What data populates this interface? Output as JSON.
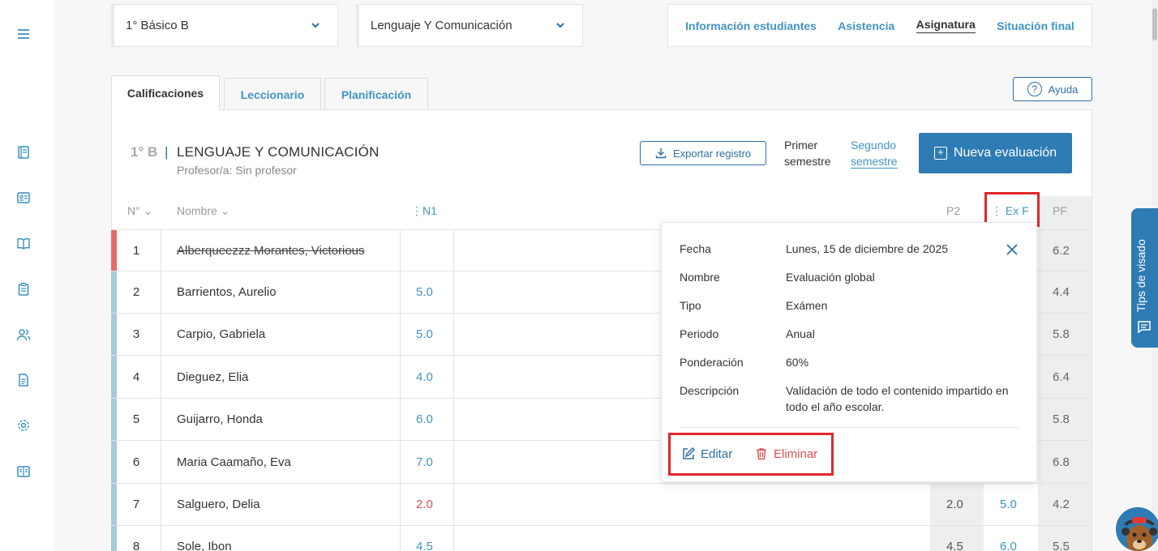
{
  "selects": {
    "curso": "1° Básico B",
    "asignatura": "Lenguaje Y Comunicación"
  },
  "topnav": [
    "Información estudiantes",
    "Asistencia",
    "Asignatura",
    "Situación final"
  ],
  "tabs": [
    "Calificaciones",
    "Leccionario",
    "Planificación"
  ],
  "help": "Ayuda",
  "course": {
    "code": "1° B",
    "separator": "|",
    "name": "LENGUAJE Y COMUNICACIÓN",
    "teacher": "Profesor/a: Sin profesor"
  },
  "actions": {
    "export": "Exportar registro",
    "sem1_line1": "Primer",
    "sem1_line2": "semestre",
    "sem2_line1": "Segundo",
    "sem2_line2": "semestre",
    "new_eval": "Nueva evaluación"
  },
  "table_header": {
    "num": "N°",
    "name": "Nombre",
    "n1": "N1",
    "p2": "P2",
    "exf": "Ex F",
    "pf": "PF"
  },
  "rows": [
    {
      "num": "1",
      "name": "Alberqueezzz Morantes, Victorious",
      "n1": "",
      "p2": "",
      "exf": "",
      "pf": "6.2"
    },
    {
      "num": "2",
      "name": "Barrientos, Aurelio",
      "n1": "5.0",
      "p2": "",
      "exf": "",
      "pf": "4.4"
    },
    {
      "num": "3",
      "name": "Carpio, Gabriela",
      "n1": "5.0",
      "p2": "",
      "exf": "",
      "pf": "5.8"
    },
    {
      "num": "4",
      "name": "Dieguez, Elia",
      "n1": "4.0",
      "p2": "",
      "exf": "",
      "pf": "6.4"
    },
    {
      "num": "5",
      "name": "Guijarro, Honda",
      "n1": "6.0",
      "p2": "",
      "exf": "",
      "pf": "5.8"
    },
    {
      "num": "6",
      "name": "Maria Caamaño, Eva",
      "n1": "7.0",
      "p2": "",
      "exf": "",
      "pf": "6.8"
    },
    {
      "num": "7",
      "name": "Salguero, Delia",
      "n1": "2.0",
      "p2": "2.0",
      "exf": "5.0",
      "pf": "4.2"
    },
    {
      "num": "8",
      "name": "Sole, Ibon",
      "n1": "4.5",
      "p2": "4.5",
      "exf": "6.0",
      "pf": "5.5"
    }
  ],
  "popover": {
    "fecha_label": "Fecha",
    "fecha": "Lunes, 15 de diciembre de 2025",
    "nombre_label": "Nombre",
    "nombre": "Evaluación global",
    "tipo_label": "Tipo",
    "tipo": "Exámen",
    "periodo_label": "Periodo",
    "periodo": "Anual",
    "ponderacion_label": "Ponderación",
    "ponderacion": "60%",
    "descripcion_label": "Descripción",
    "descripcion": "Validación de todo el contenido impartido en todo el año escolar.",
    "edit": "Editar",
    "delete": "Eliminar"
  },
  "tips": "Tips de visado",
  "colors": {
    "primary": "#2f7bb4",
    "link": "#4294c4",
    "danger": "#e05050",
    "highlight": "#e0282b"
  }
}
